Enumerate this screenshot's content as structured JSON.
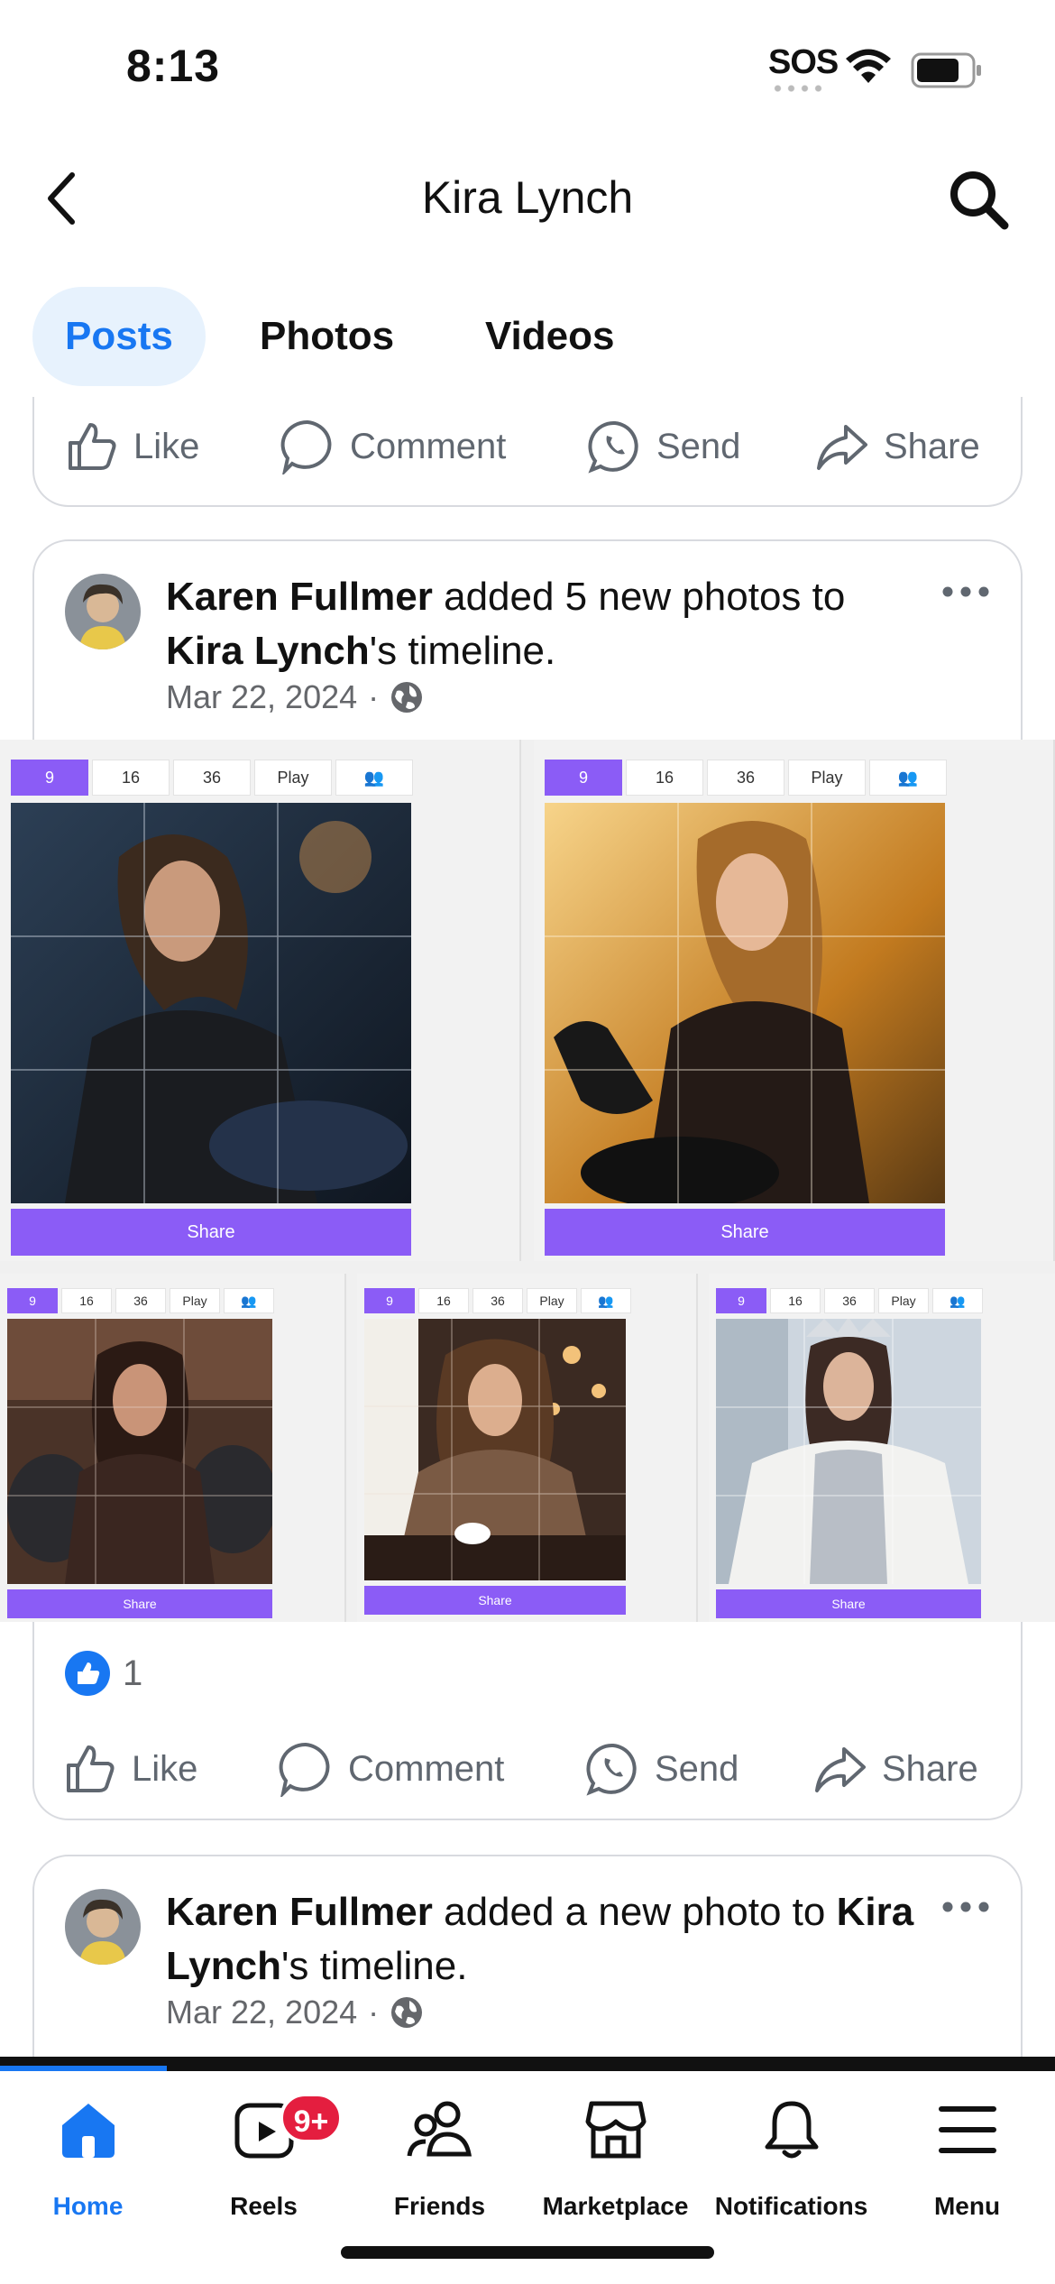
{
  "status": {
    "time": "8:13",
    "sos": "SOS"
  },
  "header": {
    "title": "Kira Lynch"
  },
  "tabs": [
    {
      "label": "Posts",
      "active": true
    },
    {
      "label": "Photos",
      "active": false
    },
    {
      "label": "Videos",
      "active": false
    }
  ],
  "actions": {
    "like": "Like",
    "comment": "Comment",
    "send": "Send",
    "share": "Share"
  },
  "post1": {
    "author": "Karen Fullmer",
    "text_mid": " added 5 new photos to ",
    "target": "Kira Lynch",
    "text_end": "'s timeline.",
    "date": "Mar 22, 2024",
    "reaction_count": "1",
    "tile_buttons": [
      "9",
      "16",
      "36",
      "Play"
    ],
    "tile_share": "Share"
  },
  "post2": {
    "author": "Karen Fullmer",
    "text_mid": " added a new photo to ",
    "target": "Kira Lynch",
    "text_end": "'s timeline.",
    "date": "Mar 22, 2024"
  },
  "nav": {
    "items": [
      {
        "label": "Home",
        "active": true
      },
      {
        "label": "Reels",
        "badge": "9+"
      },
      {
        "label": "Friends"
      },
      {
        "label": "Marketplace"
      },
      {
        "label": "Notifications"
      },
      {
        "label": "Menu"
      }
    ]
  },
  "colors": {
    "accent": "#1877f2",
    "puzzle": "#8b5cf6",
    "badge": "#e41e3f",
    "tab_bg": "#e7f2fd"
  }
}
